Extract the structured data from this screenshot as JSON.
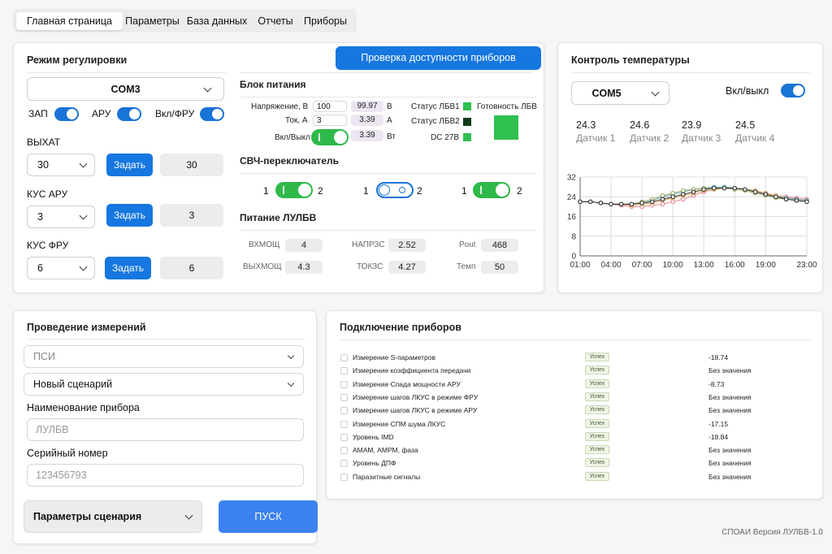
{
  "nav": {
    "tabs": [
      "Главная страница",
      "Параметры",
      "База данных",
      "Отчеты",
      "Приборы"
    ],
    "active": 0
  },
  "regulation": {
    "title": "Режим регулировки",
    "check_button": "Проверка доступности приборов",
    "port": "COM3",
    "toggles": [
      {
        "label": "ЗАП",
        "on": true
      },
      {
        "label": "АРУ",
        "on": true
      },
      {
        "label": "Вкл/ФРУ",
        "on": true
      }
    ],
    "rows": [
      {
        "label": "ВЫХАТ",
        "select": "30",
        "button": "Задать",
        "value": "30"
      },
      {
        "label": "КУС АРУ",
        "select": "3",
        "button": "Задать",
        "value": "3"
      },
      {
        "label": "КУС ФРУ",
        "select": "6",
        "button": "Задать",
        "value": "6"
      }
    ],
    "power": {
      "title": "Блок питания",
      "voltage_label": "Напряжение, В",
      "voltage_input": "100",
      "voltage_value": "99.97",
      "voltage_unit": "В",
      "current_label": "Ток, А",
      "current_input": "3",
      "current_value": "3.39",
      "current_unit": "А",
      "onoff_label": "Вкл/Выкл",
      "power_value": "3.39",
      "power_unit": "Вт",
      "status1_label": "Статус ЛБВ1",
      "status2_label": "Статус ЛБВ2",
      "dc_label": "DC 27В",
      "ready_label": "Готовность ЛБВ",
      "status1_color": "#2fc04f",
      "status2_color": "#0d3b17",
      "dc_color": "#2fc04f",
      "ready_color": "#2fc04f"
    },
    "switch": {
      "title": "СВЧ-переключатель",
      "items": [
        {
          "left": "1",
          "right": "2",
          "state": "green"
        },
        {
          "left": "1",
          "right": "2",
          "state": "blue"
        },
        {
          "left": "1",
          "right": "2",
          "state": "green"
        }
      ]
    },
    "lulbv": {
      "title": "Питание ЛУЛБВ",
      "cells": [
        {
          "label": "ВХМОЩ",
          "value": "4"
        },
        {
          "label": "НАПРЗС",
          "value": "2.52"
        },
        {
          "label": "Pout",
          "value": "468"
        },
        {
          "label": "ВЫХМОЩ",
          "value": "4.3"
        },
        {
          "label": "ТОКЗС",
          "value": "4.27"
        },
        {
          "label": "Темп",
          "value": "50"
        }
      ]
    }
  },
  "temperature": {
    "title": "Контроль температуры",
    "port": "COM5",
    "toggle_label": "Вкл/выкл",
    "toggle_on": true,
    "sensors": [
      {
        "value": "24.3",
        "name": "Датчик 1"
      },
      {
        "value": "24.6",
        "name": "Датчик 2"
      },
      {
        "value": "23.9",
        "name": "Датчик 3"
      },
      {
        "value": "24.5",
        "name": "Датчик 4"
      }
    ]
  },
  "chart_data": {
    "type": "line",
    "x": [
      "01:00",
      "02:00",
      "03:00",
      "04:00",
      "05:00",
      "06:00",
      "07:00",
      "08:00",
      "09:00",
      "10:00",
      "11:00",
      "12:00",
      "13:00",
      "14:00",
      "15:00",
      "16:00",
      "17:00",
      "18:00",
      "19:00",
      "20:00",
      "21:00",
      "22:00",
      "23:00"
    ],
    "x_ticks": [
      "01:00",
      "04:00",
      "07:00",
      "10:00",
      "13:00",
      "16:00",
      "19:00",
      "23:00"
    ],
    "y_ticks": [
      0,
      8,
      16,
      24,
      32
    ],
    "ylim": [
      0,
      32
    ],
    "grid": true,
    "series": [
      {
        "color": "#e07a8a",
        "values": [
          22,
          22,
          21.5,
          21,
          20.5,
          20,
          20,
          20.5,
          21,
          22,
          23,
          24.5,
          26,
          27,
          27.5,
          27.5,
          27,
          26.5,
          25.5,
          24.5,
          24,
          23.5,
          23
        ]
      },
      {
        "color": "#d29a4a",
        "values": [
          22,
          22,
          21.5,
          21,
          21,
          20.5,
          21,
          21.5,
          22.5,
          23.5,
          24.5,
          25.5,
          26.5,
          27,
          27.5,
          27.5,
          27,
          26.5,
          25.5,
          24.5,
          23.5,
          23,
          22.5
        ]
      },
      {
        "color": "#4f9fb5",
        "values": [
          22,
          22,
          21.5,
          21,
          21,
          21,
          21.5,
          22.5,
          24,
          25,
          26,
          27,
          27.5,
          28,
          28,
          27.5,
          27,
          26,
          25,
          24,
          23.5,
          23,
          22.5
        ]
      },
      {
        "color": "#9aa65a",
        "values": [
          22,
          22,
          21.5,
          21,
          21,
          21,
          22,
          23,
          24.5,
          25.5,
          26.5,
          27,
          27.5,
          27.5,
          27.5,
          27,
          26.5,
          25.5,
          24.5,
          23.5,
          23,
          22.5,
          22
        ]
      },
      {
        "color": "#222222",
        "values": [
          22,
          22,
          21.5,
          21,
          21,
          21,
          21.5,
          22,
          23,
          24,
          25,
          26,
          27,
          27.5,
          27.5,
          27.5,
          27,
          26,
          25,
          24,
          23,
          22.5,
          22
        ]
      }
    ]
  },
  "measure": {
    "title": "Проведение измерений",
    "type_select": "ПСИ",
    "scenario_select": "Новый сценарий",
    "device_label": "Наименование прибора",
    "device_placeholder": "ЛУЛБВ",
    "serial_label": "Серийный номер",
    "serial_placeholder": "123456793",
    "params_button": "Параметры сценария",
    "start_button": "ПУСК"
  },
  "devices": {
    "title": "Подключение приборов",
    "rows": [
      {
        "name": "Измерение S-параметров",
        "status": "Успех",
        "value": "-18.74"
      },
      {
        "name": "Измерение коэффициента передачи",
        "status": "Успех",
        "value": "Без значения"
      },
      {
        "name": "Измерение Спада мощности АРУ",
        "status": "Успех",
        "value": "-8.73"
      },
      {
        "name": "Измерение шагов ЛКУС в режиме ФРУ",
        "status": "Успех",
        "value": "Без значения"
      },
      {
        "name": "Измерение шагов ЛКУС в режиме АРУ",
        "status": "Успех",
        "value": "Без значения"
      },
      {
        "name": "Измерение СПМ шума ЛКУС",
        "status": "Успех",
        "value": "-17.15"
      },
      {
        "name": "Уровень IMD",
        "status": "Успех",
        "value": "-18.84"
      },
      {
        "name": "АМАМ, АМРМ, фаза",
        "status": "Успех",
        "value": "Без значения"
      },
      {
        "name": "Уровень ДПФ",
        "status": "Успех",
        "value": "Без значения"
      },
      {
        "name": "Паразитные сигналы",
        "status": "Успех",
        "value": "Без значения"
      }
    ]
  },
  "footer": {
    "version": "СПОАИ Версия ЛУЛБВ-1.0"
  }
}
